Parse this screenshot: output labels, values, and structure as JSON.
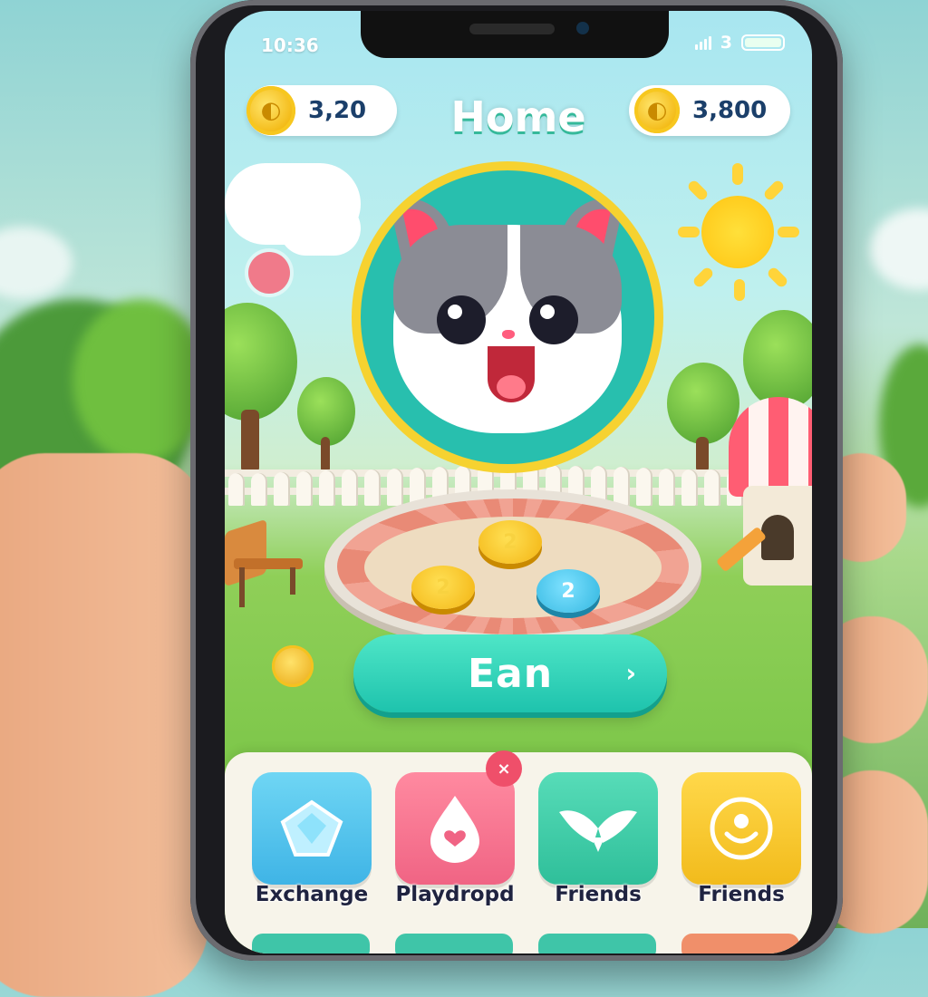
{
  "status_bar": {
    "time": "10:36",
    "battery_text": "3"
  },
  "header": {
    "title": "Home",
    "left_balance": {
      "value": "3,20",
      "icon": "coin-icon"
    },
    "right_balance": {
      "value": "3,800",
      "icon": "coin-icon"
    }
  },
  "scene": {
    "tokens": [
      {
        "label": "2",
        "color": "#f3b412"
      },
      {
        "label": "2",
        "color": "#f3b412"
      },
      {
        "label": "2",
        "color": "#32b7e0"
      }
    ]
  },
  "earn_button": {
    "label": "Ean",
    "chevron": "›"
  },
  "bottom_nav": {
    "items": [
      {
        "label": "Exchange",
        "icon": "gem-icon",
        "color": "#55c7ec"
      },
      {
        "label": "Playdropd",
        "icon": "drop-icon",
        "color": "#f36e86",
        "badge": "×"
      },
      {
        "label": "Friends",
        "icon": "wings-icon",
        "color": "#38c9a4"
      },
      {
        "label": "Friends",
        "icon": "smile-coin-icon",
        "color": "#f6c72c"
      }
    ]
  },
  "colors": {
    "accent": "#1ec3ad",
    "title_shadow": "#35b99a",
    "coin": "#f3b812"
  }
}
